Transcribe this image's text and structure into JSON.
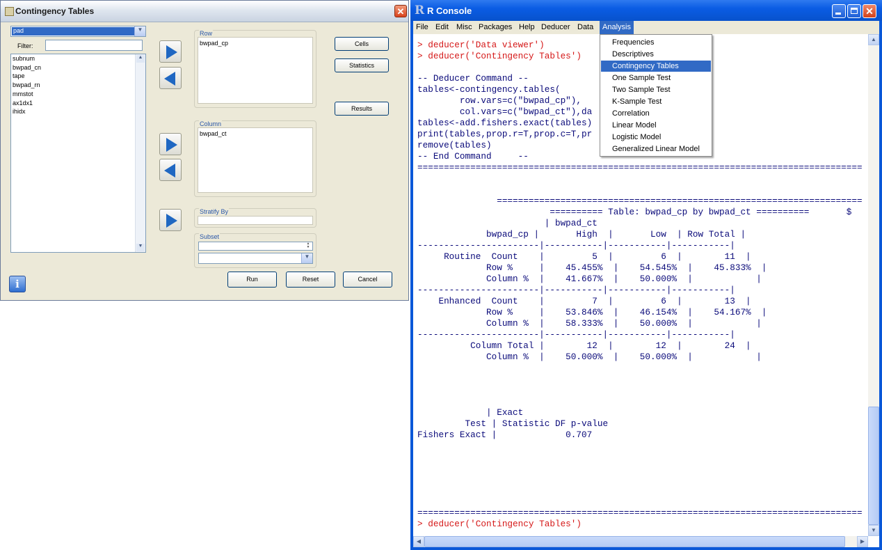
{
  "ct": {
    "title": "Contingency Tables",
    "dataset": "pad",
    "filter_label": "Filter:",
    "filter_value": "",
    "variables": [
      "subnum",
      "bwpad_cn",
      "tape",
      "bwpad_rn",
      "mmstot",
      "ax1dx1",
      "ihidx"
    ],
    "row_label": "Row",
    "row_vars": [
      "bwpad_cp"
    ],
    "column_label": "Column",
    "column_vars": [
      "bwpad_ct"
    ],
    "stratify_label": "Stratify By",
    "subset_label": "Subset",
    "cells_label": "Cells",
    "statistics_label": "Statistics",
    "results_label": "Results",
    "run_label": "Run",
    "reset_label": "Reset",
    "cancel_label": "Cancel",
    "close_glyph": "✕",
    "info_glyph": "i"
  },
  "rc": {
    "title": "R Console",
    "r_glyph": "R",
    "close_glyph": "✕",
    "menu": [
      "File",
      "Edit",
      "Misc",
      "Packages",
      "Help",
      "Deducer",
      "Data",
      "Analysis"
    ],
    "active_menu": "Analysis",
    "analysis_items": [
      "Frequencies",
      "Descriptives",
      "Contingency Tables",
      "One Sample Test",
      "Two Sample Test",
      "K-Sample Test",
      "Correlation",
      "Linear Model",
      "Logistic Model",
      "Generalized Linear Model"
    ],
    "highlighted_item": "Contingency Tables",
    "console_lines": [
      {
        "t": "> deducer('Data viewer')",
        "c": "cmd"
      },
      {
        "t": "> deducer('Contingency Tables')",
        "c": "cmd"
      },
      {
        "t": "",
        "c": "out"
      },
      {
        "t": "-- Deducer Command --",
        "c": "out"
      },
      {
        "t": "tables<-contingency.tables(",
        "c": "out"
      },
      {
        "t": "        row.vars=c(\"bwpad_cp\"),",
        "c": "out"
      },
      {
        "t": "        col.vars=c(\"bwpad_ct\"),da",
        "c": "out"
      },
      {
        "t": "tables<-add.fishers.exact(tables)",
        "c": "out"
      },
      {
        "t": "print(tables,prop.r=T,prop.c=T,pr",
        "c": "out"
      },
      {
        "t": "remove(tables)",
        "c": "out"
      },
      {
        "t": "-- End Command     --",
        "c": "out"
      },
      {
        "t": "=====================================================================================$",
        "c": "out"
      },
      {
        "t": "",
        "c": "out"
      },
      {
        "t": "",
        "c": "out"
      },
      {
        "t": "               ======================================================================$",
        "c": "out"
      },
      {
        "t": "                         ========== Table: bwpad_cp by bwpad_ct ==========       $",
        "c": "out"
      },
      {
        "t": "                        | bwpad_ct",
        "c": "out"
      },
      {
        "t": "             bwpad_cp |       High  |       Low  | Row Total |",
        "c": "out"
      },
      {
        "t": "-----------------------|-----------|-----------|-----------|",
        "c": "out"
      },
      {
        "t": "     Routine  Count    |         5  |         6  |        11  |",
        "c": "out"
      },
      {
        "t": "             Row %     |    45.455%  |    54.545%  |    45.833%  |",
        "c": "out"
      },
      {
        "t": "             Column %  |    41.667%  |    50.000%  |            |",
        "c": "out"
      },
      {
        "t": "-----------------------|-----------|-----------|-----------|",
        "c": "out"
      },
      {
        "t": "    Enhanced  Count    |         7  |         6  |        13  |",
        "c": "out"
      },
      {
        "t": "             Row %     |    53.846%  |    46.154%  |    54.167%  |",
        "c": "out"
      },
      {
        "t": "             Column %  |    58.333%  |    50.000%  |            |",
        "c": "out"
      },
      {
        "t": "-----------------------|-----------|-----------|-----------|",
        "c": "out"
      },
      {
        "t": "          Column Total |        12  |        12  |        24  |",
        "c": "out"
      },
      {
        "t": "             Column %  |    50.000%  |    50.000%  |            |",
        "c": "out"
      },
      {
        "t": "",
        "c": "out"
      },
      {
        "t": "",
        "c": "out"
      },
      {
        "t": "",
        "c": "out"
      },
      {
        "t": "",
        "c": "out"
      },
      {
        "t": "             | Exact",
        "c": "out"
      },
      {
        "t": "         Test | Statistic DF p-value",
        "c": "out"
      },
      {
        "t": "Fishers Exact |             0.707",
        "c": "out"
      },
      {
        "t": "",
        "c": "out"
      },
      {
        "t": "",
        "c": "out"
      },
      {
        "t": "",
        "c": "out"
      },
      {
        "t": "",
        "c": "out"
      },
      {
        "t": "",
        "c": "out"
      },
      {
        "t": "",
        "c": "out"
      },
      {
        "t": "=====================================================================================$",
        "c": "out"
      },
      {
        "t": "> deducer('Contingency Tables')",
        "c": "cmd"
      },
      {
        "t": "> deducer('Contingency Tables')",
        "c": "cmd"
      },
      {
        "t": "> deducer('Contingency Tables')",
        "c": "cmd"
      },
      {
        "t": "> ",
        "c": "cmd"
      }
    ]
  }
}
